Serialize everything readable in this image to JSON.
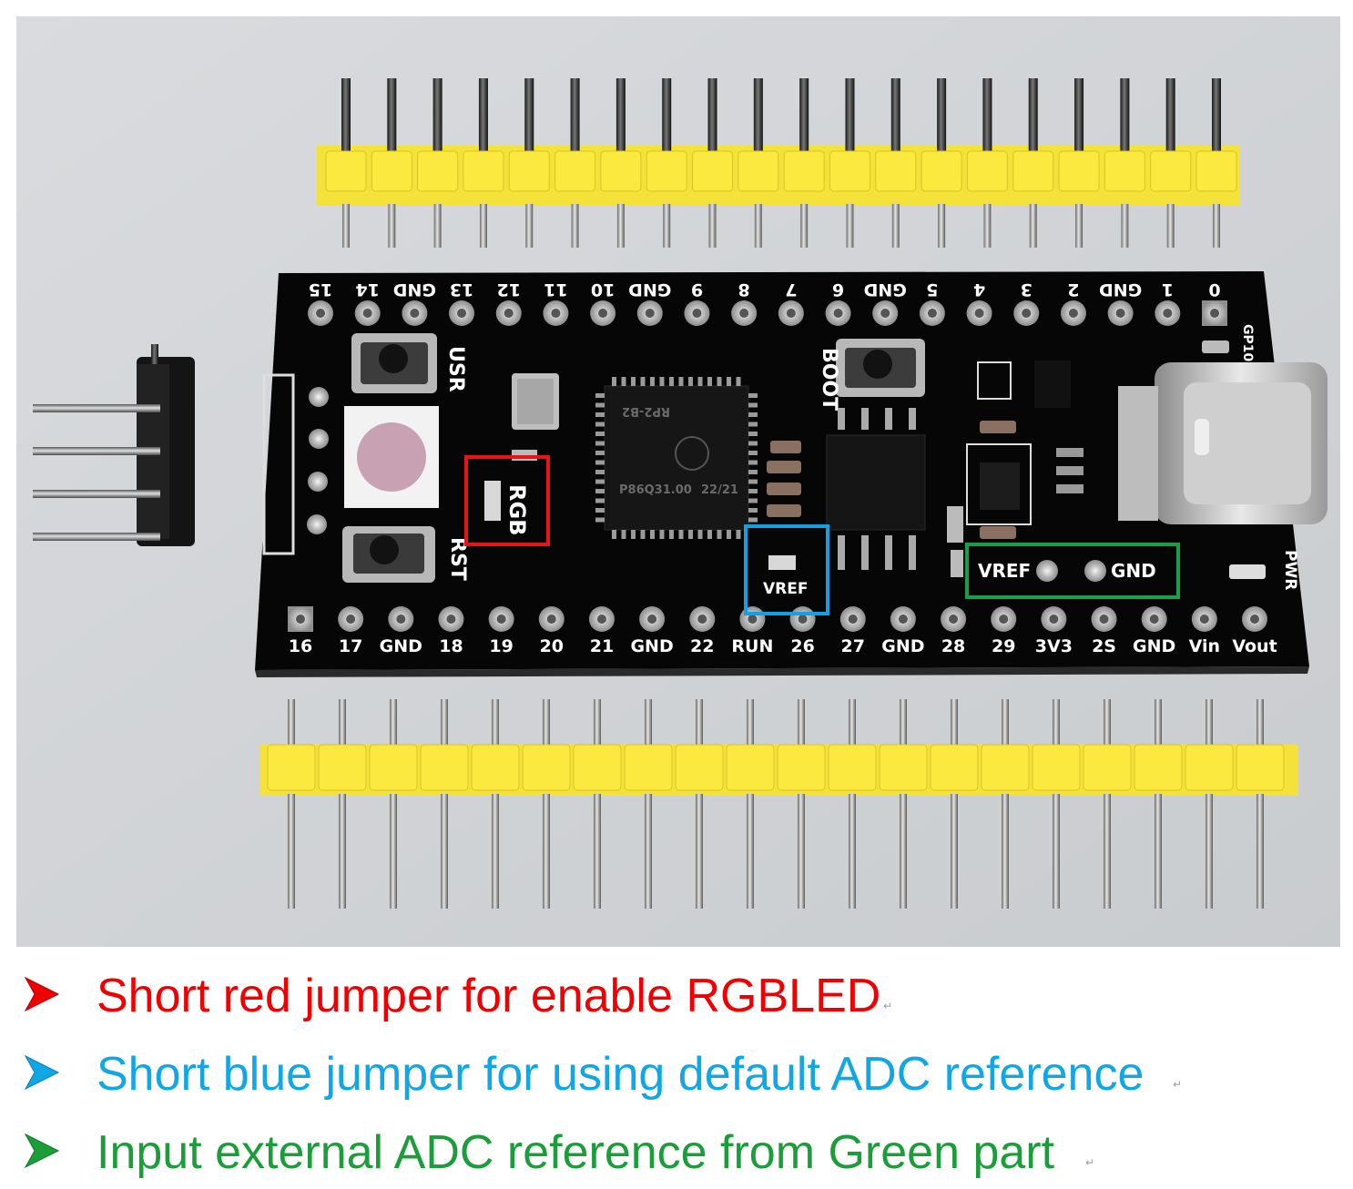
{
  "top_header_labels": [
    "15",
    "14",
    "GND",
    "13",
    "12",
    "11",
    "10",
    "GND",
    "9",
    "8",
    "7",
    "6",
    "GND",
    "5",
    "4",
    "3",
    "2",
    "GND",
    "1",
    "0"
  ],
  "bottom_header_labels": [
    "16",
    "17",
    "GND",
    "18",
    "19",
    "20",
    "21",
    "GND",
    "22",
    "RUN",
    "26",
    "27",
    "GND",
    "28",
    "29",
    "3V3",
    "2S",
    "GND",
    "Vin",
    "Vout"
  ],
  "silkscreen": {
    "usr": "USR",
    "rst": "RST",
    "boot": "BOOT",
    "pwr": "PWR",
    "gpio": "GP10",
    "rgb_jumper": "RGB",
    "vref_jumper": "VREF",
    "ext_vref": "VREF",
    "ext_gnd": "GND",
    "mcu_line1": "RP2-B2",
    "mcu_line2": "P86Q31.00",
    "mcu_line3": "22/21"
  },
  "highlight_colors": {
    "red": "#e8141a",
    "blue": "#14a0e0",
    "green": "#16a04a"
  },
  "notes": [
    {
      "text": "Short red jumper for enable RGBLED",
      "color": "#f00000",
      "marker": "↵",
      "icon": "arrowhead-icon"
    },
    {
      "text": "Short blue jumper for using default ADC reference",
      "color": "#11a6e6",
      "marker": "↵",
      "icon": "arrowhead-icon"
    },
    {
      "text": "Input external ADC reference from Green part",
      "color": "#1b9e3a",
      "marker": "↵",
      "icon": "arrowhead-icon"
    }
  ]
}
